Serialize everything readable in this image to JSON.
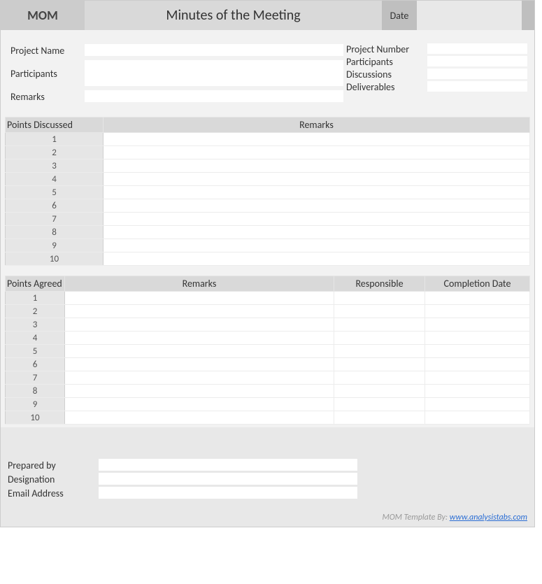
{
  "header": {
    "badge": "MOM",
    "title": "Minutes of the Meeting",
    "date_label": "Date",
    "date_value": ""
  },
  "info_left": {
    "project_name_label": "Project Name",
    "project_name_value": "",
    "participants_label": "Participants",
    "participants_value": "",
    "remarks_label": "Remarks",
    "remarks_value": ""
  },
  "info_right": {
    "project_number_label": "Project Number",
    "project_number_value": "",
    "participants_label": "Participants",
    "participants_value": "",
    "discussions_label": "Discussions",
    "discussions_value": "",
    "deliverables_label": "Deliverables",
    "deliverables_value": ""
  },
  "points_discussed": {
    "header_points": "Points Discussed",
    "header_remarks": "Remarks",
    "rows": [
      {
        "n": "1",
        "remarks": ""
      },
      {
        "n": "2",
        "remarks": ""
      },
      {
        "n": "3",
        "remarks": ""
      },
      {
        "n": "4",
        "remarks": ""
      },
      {
        "n": "5",
        "remarks": ""
      },
      {
        "n": "6",
        "remarks": ""
      },
      {
        "n": "7",
        "remarks": ""
      },
      {
        "n": "8",
        "remarks": ""
      },
      {
        "n": "9",
        "remarks": ""
      },
      {
        "n": "10",
        "remarks": ""
      }
    ]
  },
  "points_agreed": {
    "header_points": "Points Agreed",
    "header_remarks": "Remarks",
    "header_responsible": "Responsible",
    "header_completion": "Completion Date",
    "rows": [
      {
        "n": "1",
        "remarks": "",
        "responsible": "",
        "completion": ""
      },
      {
        "n": "2",
        "remarks": "",
        "responsible": "",
        "completion": ""
      },
      {
        "n": "3",
        "remarks": "",
        "responsible": "",
        "completion": ""
      },
      {
        "n": "4",
        "remarks": "",
        "responsible": "",
        "completion": ""
      },
      {
        "n": "5",
        "remarks": "",
        "responsible": "",
        "completion": ""
      },
      {
        "n": "6",
        "remarks": "",
        "responsible": "",
        "completion": ""
      },
      {
        "n": "7",
        "remarks": "",
        "responsible": "",
        "completion": ""
      },
      {
        "n": "8",
        "remarks": "",
        "responsible": "",
        "completion": ""
      },
      {
        "n": "9",
        "remarks": "",
        "responsible": "",
        "completion": ""
      },
      {
        "n": "10",
        "remarks": "",
        "responsible": "",
        "completion": ""
      }
    ]
  },
  "prepared": {
    "prepared_by_label": "Prepared by",
    "prepared_by_value": "",
    "designation_label": "Designation",
    "designation_value": "",
    "email_label": "Email Address",
    "email_value": ""
  },
  "credit": {
    "prefix": "MOM Template By:  ",
    "link_text": "www.analysistabs.com"
  }
}
